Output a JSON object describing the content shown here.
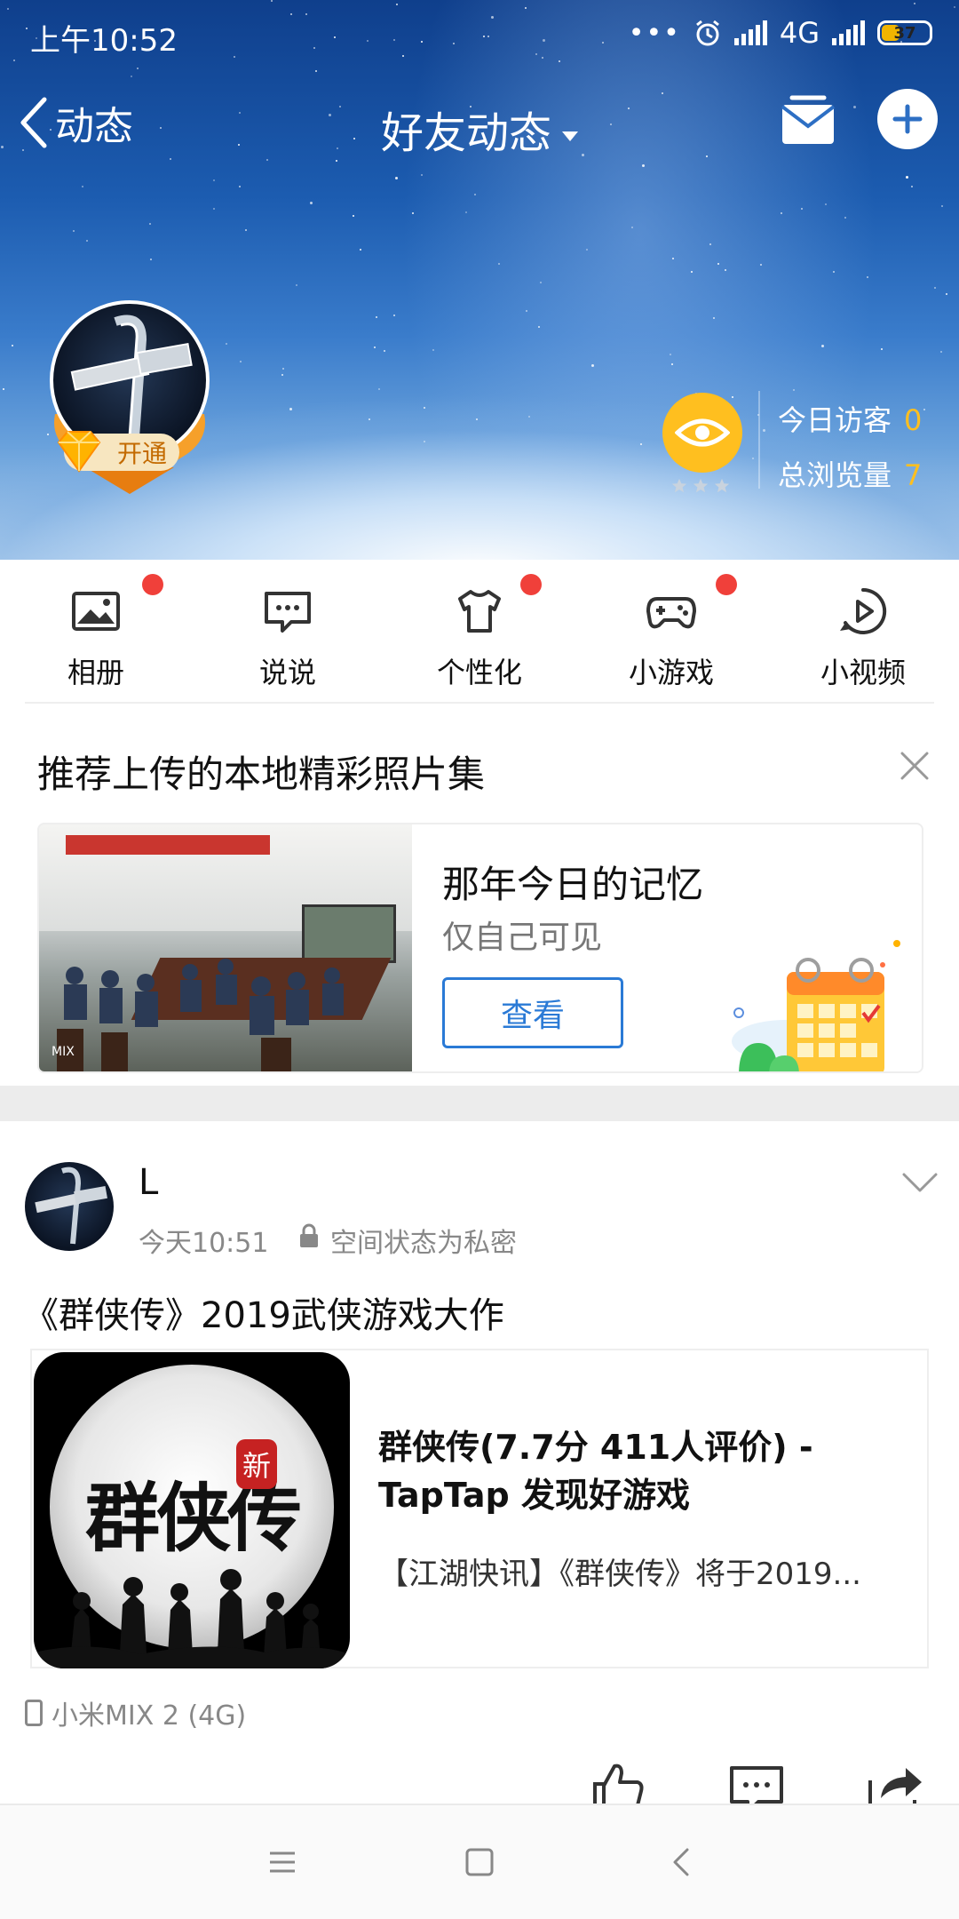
{
  "status_bar": {
    "time": "上午10:52",
    "dots": "•••",
    "network": "4G",
    "battery": "37"
  },
  "nav": {
    "back_label": "动态",
    "title": "好友动态"
  },
  "profile": {
    "vip_label": "开通",
    "visitors_today_label": "今日访客",
    "visitors_today_value": "0",
    "total_views_label": "总浏览量",
    "total_views_value": "7"
  },
  "shortcuts": [
    {
      "label": "相册",
      "icon": "photo-album-icon",
      "badge": true
    },
    {
      "label": "说说",
      "icon": "chat-bubble-icon",
      "badge": false
    },
    {
      "label": "个性化",
      "icon": "tshirt-icon",
      "badge": true
    },
    {
      "label": "小游戏",
      "icon": "gamepad-icon",
      "badge": true
    },
    {
      "label": "小视频",
      "icon": "play-circle-icon",
      "badge": false
    }
  ],
  "recommend": {
    "title": "推荐上传的本地精彩照片集",
    "card_title": "那年今日的记忆",
    "card_subtitle": "仅自己可见",
    "button": "查看",
    "photo_watermark": "MIX"
  },
  "post": {
    "author": "L",
    "time": "今天10:51",
    "privacy": "空间状态为私密",
    "text": "《群侠传》2019武侠游戏大作",
    "link_title": "群侠传(7.7分 411人评价) - TapTap 发现好游戏",
    "link_desc": "【江湖快讯】《群侠传》将于2019...",
    "game_logo_text": "群侠传",
    "game_logo_seal": "新",
    "device": "小米MIX 2 (4G)"
  },
  "colors": {
    "accent_blue": "#2a7ad6",
    "badge_red": "#f0403a",
    "gold": "#ffbf1f"
  }
}
